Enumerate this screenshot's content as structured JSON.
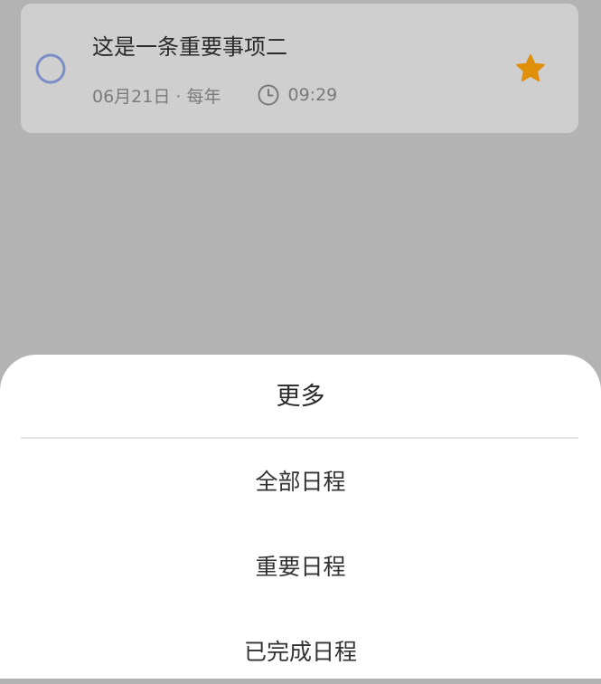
{
  "task": {
    "title": "这是一条重要事项二",
    "date_repeat": "06月21日 · 每年",
    "time": "09:29",
    "check_icon": "circle-outline-icon",
    "clock_icon": "clock-icon",
    "star_icon": "star-icon",
    "colors": {
      "check": "#7d8ec7",
      "star": "#e08f0b"
    }
  },
  "sheet": {
    "title": "更多",
    "options": [
      {
        "label": "全部日程"
      },
      {
        "label": "重要日程"
      },
      {
        "label": "已完成日程"
      }
    ]
  }
}
